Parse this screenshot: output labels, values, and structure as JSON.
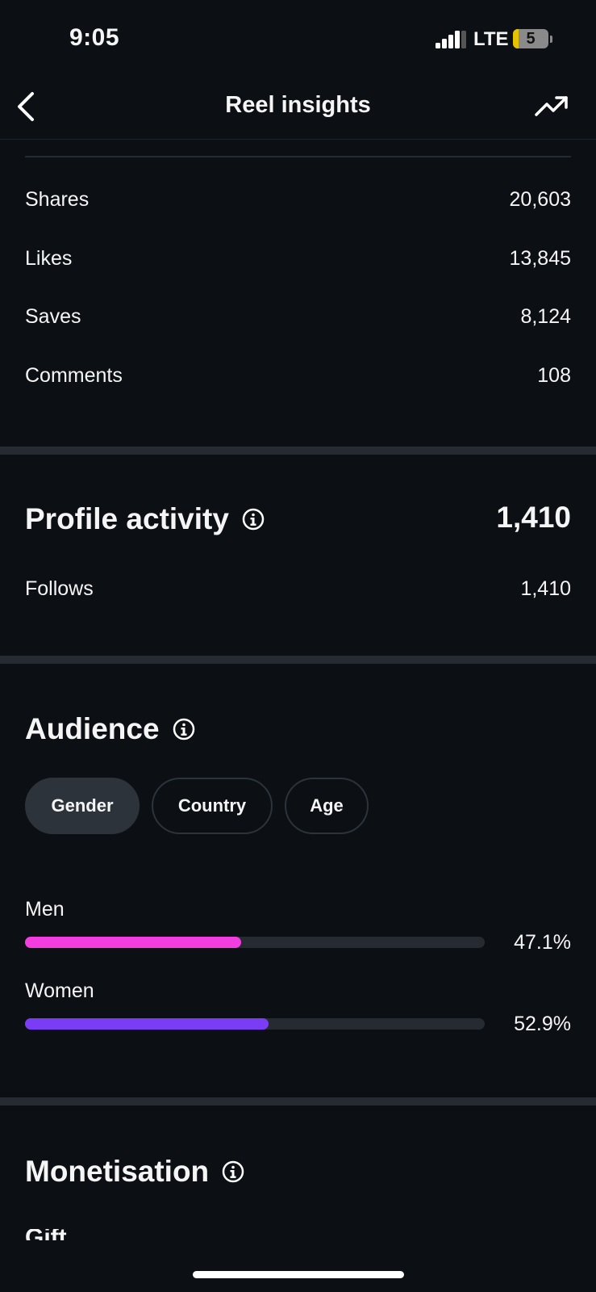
{
  "status_bar": {
    "time": "9:05",
    "network": "LTE",
    "battery": "5"
  },
  "header": {
    "title": "Reel insights",
    "back_icon": "chevron-left-icon",
    "trend_icon": "trending-up-icon"
  },
  "interactions": [
    {
      "label": "Shares",
      "value": "20,603"
    },
    {
      "label": "Likes",
      "value": "13,845"
    },
    {
      "label": "Saves",
      "value": "8,124"
    },
    {
      "label": "Comments",
      "value": "108"
    }
  ],
  "profile_activity": {
    "title": "Profile activity",
    "total": "1,410",
    "rows": [
      {
        "label": "Follows",
        "value": "1,410"
      }
    ]
  },
  "audience": {
    "title": "Audience",
    "tabs": [
      {
        "label": "Gender",
        "selected": true
      },
      {
        "label": "Country",
        "selected": false
      },
      {
        "label": "Age",
        "selected": false
      }
    ],
    "bars": [
      {
        "label": "Men",
        "percent": "47.1%",
        "fraction": 0.471,
        "color": "#f23de0"
      },
      {
        "label": "Women",
        "percent": "52.9%",
        "fraction": 0.529,
        "color": "#7a3cf5"
      }
    ]
  },
  "monetisation": {
    "title": "Monetisation",
    "partial_row": "Gift"
  },
  "colors": {
    "background": "#0c1014",
    "separator": "#262b31",
    "men_bar": "#f23de0",
    "women_bar": "#7a3cf5"
  }
}
